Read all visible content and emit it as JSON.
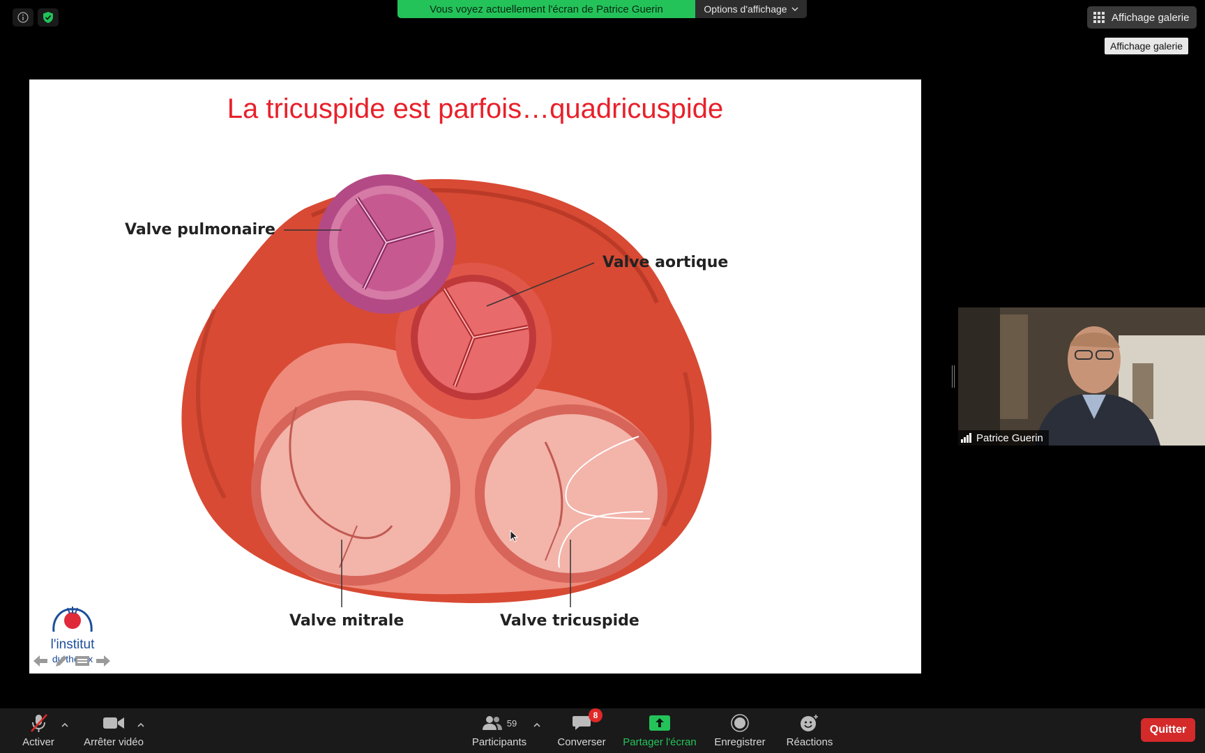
{
  "top_bar": {
    "share_banner_text": "Vous voyez actuellement l'écran de Patrice Guerin",
    "view_options_label": "Options d'affichage",
    "gallery_button_label": "Affichage galerie",
    "gallery_tooltip": "Affichage galerie",
    "info_icon": "info-icon",
    "security_icon": "shield-check-icon"
  },
  "slide": {
    "title": "La tricuspide est parfois…quadricuspide",
    "labels": {
      "pulmonary": "Valve pulmonaire",
      "aortic": "Valve aortique",
      "mitral": "Valve mitrale",
      "tricuspid": "Valve tricuspide"
    },
    "logo_line1": "l'institut",
    "logo_line2": "du thorax"
  },
  "video": {
    "participant_name": "Patrice Guerin"
  },
  "toolbar": {
    "mute_label": "Activer",
    "video_label": "Arrêter vidéo",
    "participants_label": "Participants",
    "participants_count": "59",
    "chat_label": "Converser",
    "chat_badge": "8",
    "share_label": "Partager l'écran",
    "record_label": "Enregistrer",
    "reactions_label": "Réactions",
    "quit_label": "Quitter"
  },
  "colors": {
    "share_green": "#24c35a",
    "title_red": "#e8202a",
    "quit_red": "#d42a2a"
  }
}
